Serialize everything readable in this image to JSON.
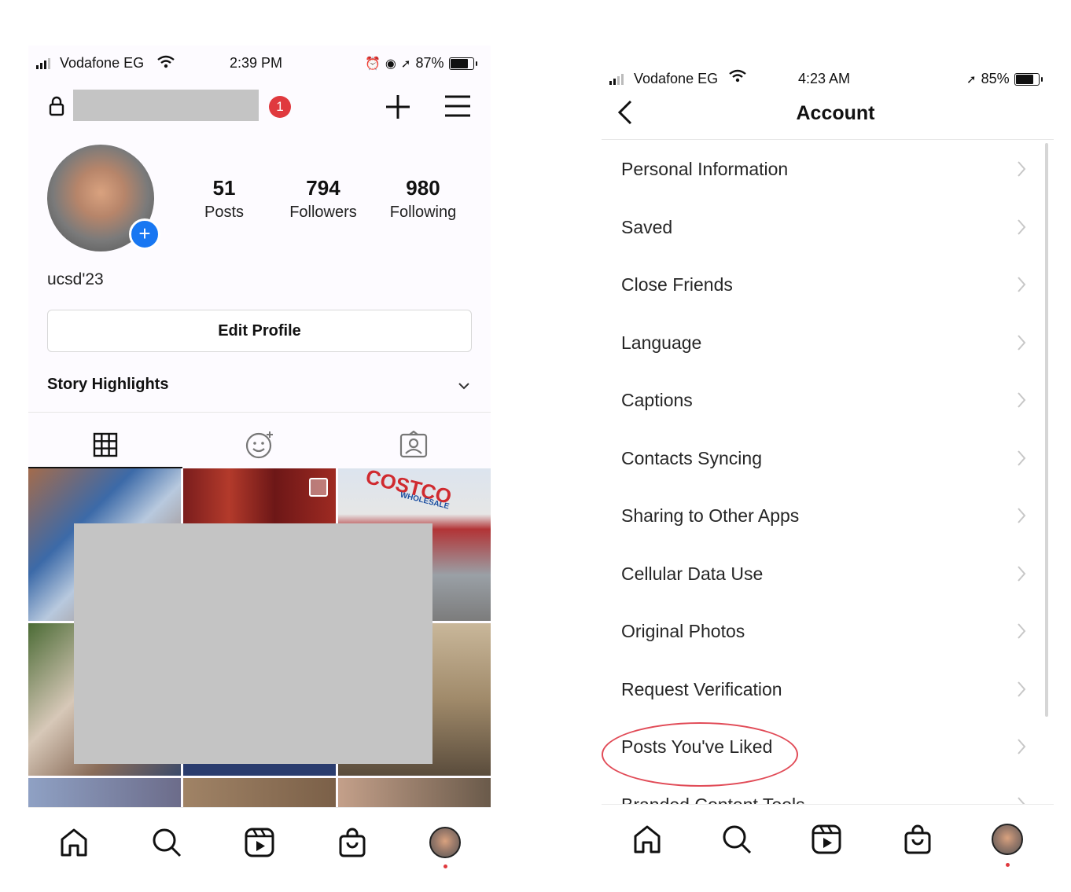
{
  "left_phone": {
    "status": {
      "carrier": "Vodafone EG",
      "time": "2:39 PM",
      "battery": "87%",
      "battery_level": 0.87
    },
    "header": {
      "notification_count": "1"
    },
    "profile": {
      "stats": [
        {
          "num": "51",
          "label": "Posts"
        },
        {
          "num": "794",
          "label": "Followers"
        },
        {
          "num": "980",
          "label": "Following"
        }
      ],
      "bio": "ucsd'23",
      "edit_button": "Edit Profile",
      "story_highlights": "Story Highlights"
    },
    "grid_sign": "COSTCO",
    "grid_sign_sub": "WHOLESALE",
    "tabs": [
      "grid-icon",
      "tagged-face-icon",
      "user-tag-icon"
    ],
    "nav": [
      "home-icon",
      "search-icon",
      "reels-icon",
      "shop-icon",
      "profile-avatar"
    ]
  },
  "right_phone": {
    "status": {
      "carrier": "Vodafone EG",
      "time": "4:23 AM",
      "battery": "85%",
      "battery_level": 0.85
    },
    "title": "Account",
    "menu": [
      "Personal Information",
      "Saved",
      "Close Friends",
      "Language",
      "Captions",
      "Contacts Syncing",
      "Sharing to Other Apps",
      "Cellular Data Use",
      "Original Photos",
      "Request Verification",
      "Posts You've Liked",
      "Branded Content Tools"
    ],
    "highlight_color": "#e14b57",
    "nav": [
      "home-icon",
      "search-icon",
      "reels-icon",
      "shop-icon",
      "profile-avatar"
    ]
  }
}
